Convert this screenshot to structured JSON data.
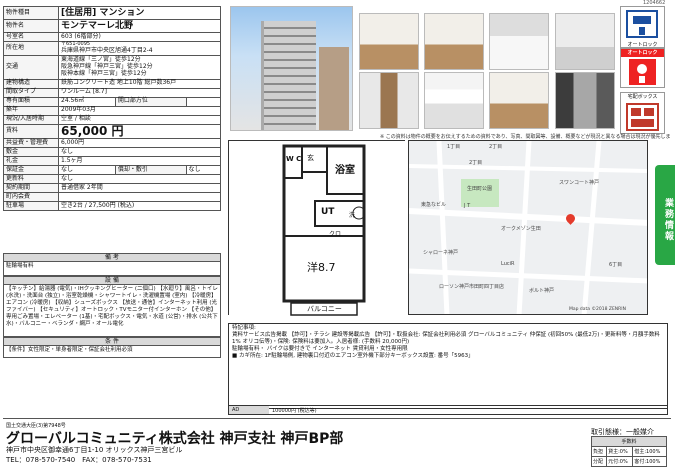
{
  "top_code": "1204662",
  "sidebar_tab": "業務情報",
  "property": {
    "kind_label": "物件種目",
    "kind_value": "[住居用] マンション",
    "name_label": "物件名",
    "name_value": "モンテマーレ北野",
    "room_label": "号室名",
    "room_value": "603 (6階部分)",
    "addr_label": "所在地",
    "postal": "〒651-0095",
    "addr_value": "兵庫県神戸市中央区旭通4丁目2-4",
    "transit_label": "交通",
    "transit": [
      "東海道線「三ノ宮」徒歩12分",
      "阪急神戸線「神戸三宮」徒歩12分",
      "阪神本線「神戸三宮」徒歩12分"
    ],
    "struct_label": "建物構造",
    "struct_value": "鉄筋コンクリート造 地上10階 総戸数36戸",
    "layout_label": "間取タイプ",
    "layout_value": "ワンルーム [8.7]",
    "area_label": "専有面積",
    "area_value": "24.56㎡",
    "opening_label": "開口部方位",
    "opening_value": "",
    "age_label": "築年",
    "age_value": "2009年03月",
    "status_label": "現況/入居時期",
    "status_value": "空室 / 相談",
    "rent_label": "賃料",
    "rent_value": "65,000 円",
    "common_label": "共益費・管理費",
    "common_value": "6,000円",
    "deposit_label": "敷金",
    "deposit_value": "なし",
    "key_label": "礼金",
    "key_value": "1.5ヶ月",
    "guarantee_label": "保証金",
    "guarantee_value": "なし",
    "amort_label": "償却・敷引",
    "amort_value": "なし",
    "renew_label": "更新料",
    "renew_value": "なし",
    "contract_label": "契約期間",
    "contract_value": "普通借家 2年間",
    "fee_label": "町内会費",
    "fee_value": "",
    "parking_label": "駐車場",
    "parking_value": "空き2台 / 27,500円 (税込)"
  },
  "bikou": {
    "head": "備 考",
    "body": "駐輪場有料"
  },
  "setsubi": {
    "head": "設 備",
    "body": "【キッチン】給湯器 (電気)・IHクッキングヒーター (二個口) 【水廻り】風呂・トイレ (水洗)・洗面台 (独立)・浴室乾燥機・シャワートイレ・洗濯機置場 (室内) 【冷暖房】エアコン (冷暖房) 【収納】シューズボックス 【放送・通信】インターネット利用 (光ファイバー) 【セキュリティ】オートロック・TVモニター付インターホン 【その他】専用ごみ置場・エレベーター (1基)・宅配ボックス・電気・水道 (公営)・排水 (公共下水)・バルコニー・ベランダ・網戸・オール電化"
  },
  "jouken": {
    "head": "条 件",
    "body": "【条件】女性限定・単身者限定・保証会社利用必須"
  },
  "icons": {
    "lock_label": "オートロック",
    "auto_label": "オートロック",
    "box_label": "宅配ボックス"
  },
  "notice": "※ この資料は物件の概要をお伝えするための資料であり、写真、間取図等、設備、概要などが現況と異なる場合は現況が優先します。",
  "floorplan": {
    "wc": "W C",
    "gen": "玄",
    "bath": "浴室",
    "ut": "UT",
    "wm": "洗",
    "kuro": "クロ",
    "room": "洋8.7",
    "balcony": "バルコニー"
  },
  "map": {
    "labels": [
      "1丁目",
      "2丁目",
      "スワンコート神戸",
      "東急なビル",
      "生田町公園",
      "J T",
      "オークメゾン生田",
      "シャローネ神戸",
      "LuciR",
      "ローソン神戸市田町四丁目店",
      "ボルト神戸",
      "2丁目",
      "6丁目"
    ],
    "footer": "Map data ©2018 ZENRIN"
  },
  "remarks": {
    "head": "特記事項:",
    "body": "賃料サービス広告掲載 【詐可】・チラシ 建設等掲載広告 【許可】・取扱会社: 保証会社利用必須 グローバルコミュニティ 仲保証 (初回50% (最低2万)・更新料等・月額手数料1% オリコ伝等)・保険: 保険料は要加入。入居者様: (手数料 20,000円)",
    "body2": "駐輪場有料・ バイクは要付きで インターネット 賃貸利用・女性専用限",
    "body3": "■ カギ所在: 1F駐輪場側, 建物裏口付近のエアコン室外機下部分キーボックス設置: 番号「5963」",
    "foot_ad": "AD",
    "foot_val": "100000円 (税込等)"
  },
  "company": {
    "license": "国土交通大臣(3)第7948号",
    "name": "グローバルコミュニティ株式会社 神戸支社 神戸BP部",
    "address": "神戸市中央区御幸通6丁目1-10 オリックス神戸三宮ビル",
    "tel": "TEL：078-570-7540　FAX：078-570-7531"
  },
  "trade": {
    "label": "取引態様：一般媒介",
    "fee_head": "手数料",
    "rows": [
      {
        "k": "負担",
        "a": "貸主:0%",
        "b": "借主:100%"
      },
      {
        "k": "分配",
        "a": "元付:0%",
        "b": "客付:100%"
      }
    ]
  }
}
